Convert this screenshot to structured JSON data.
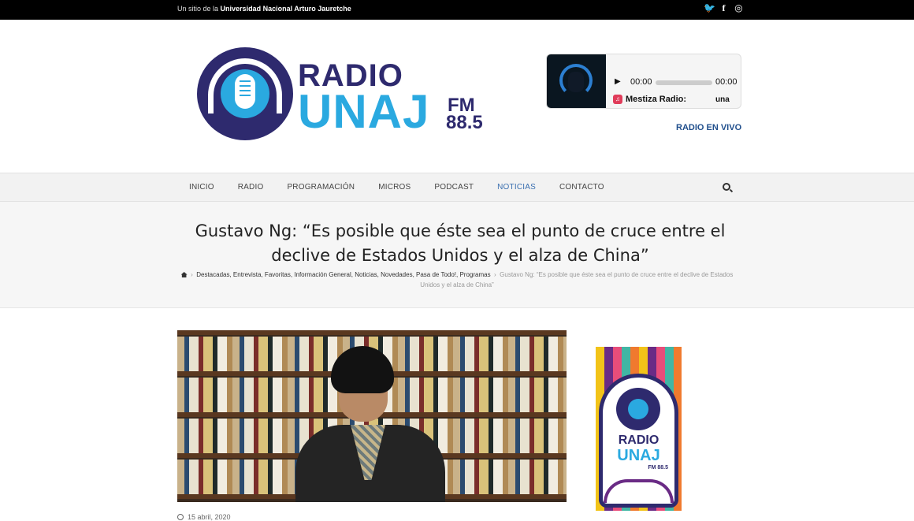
{
  "topbar": {
    "site_note_prefix": "Un sitio de la",
    "site_note_org": "Universidad Nacional Arturo Jauretche",
    "social": [
      "twitter-icon",
      "facebook-icon",
      "instagram-icon"
    ]
  },
  "logo": {
    "word1": "RADIO",
    "word2": "UNAJ",
    "fm": "FM",
    "freq": "88.5"
  },
  "player": {
    "time_start": "00:00",
    "time_end": "00:00",
    "station": "Mestiza Radio:",
    "scroll_text": "una"
  },
  "live_link": "RADIO EN VIVO",
  "nav": {
    "items": [
      "INICIO",
      "RADIO",
      "PROGRAMACIÓN",
      "MICROS",
      "PODCAST",
      "NOTICIAS",
      "CONTACTO"
    ],
    "active": "NOTICIAS"
  },
  "article": {
    "title": "Gustavo Ng: “Es posible que éste sea el punto de cruce entre el declive de Estados Unidos y el alza de China”",
    "breadcrumb_categories": "Destacadas, Entrevista, Favoritas, Información General, Noticias, Novedades, Pasa de Todo!, Programas",
    "breadcrumb_current": "Gustavo Ng: “Es posible que éste sea el punto de cruce entre el declive de Estados Unidos y el alza de China”",
    "date": "15 abril, 2020"
  },
  "banner": {
    "word1": "RADIO",
    "word2": "UNAJ",
    "fm": "FM 88.5"
  },
  "colors": {
    "brand_navy": "#2e2a6e",
    "brand_blue": "#2aa9e0",
    "link": "#1f4e8c",
    "nav_active": "#3a6fb0"
  }
}
